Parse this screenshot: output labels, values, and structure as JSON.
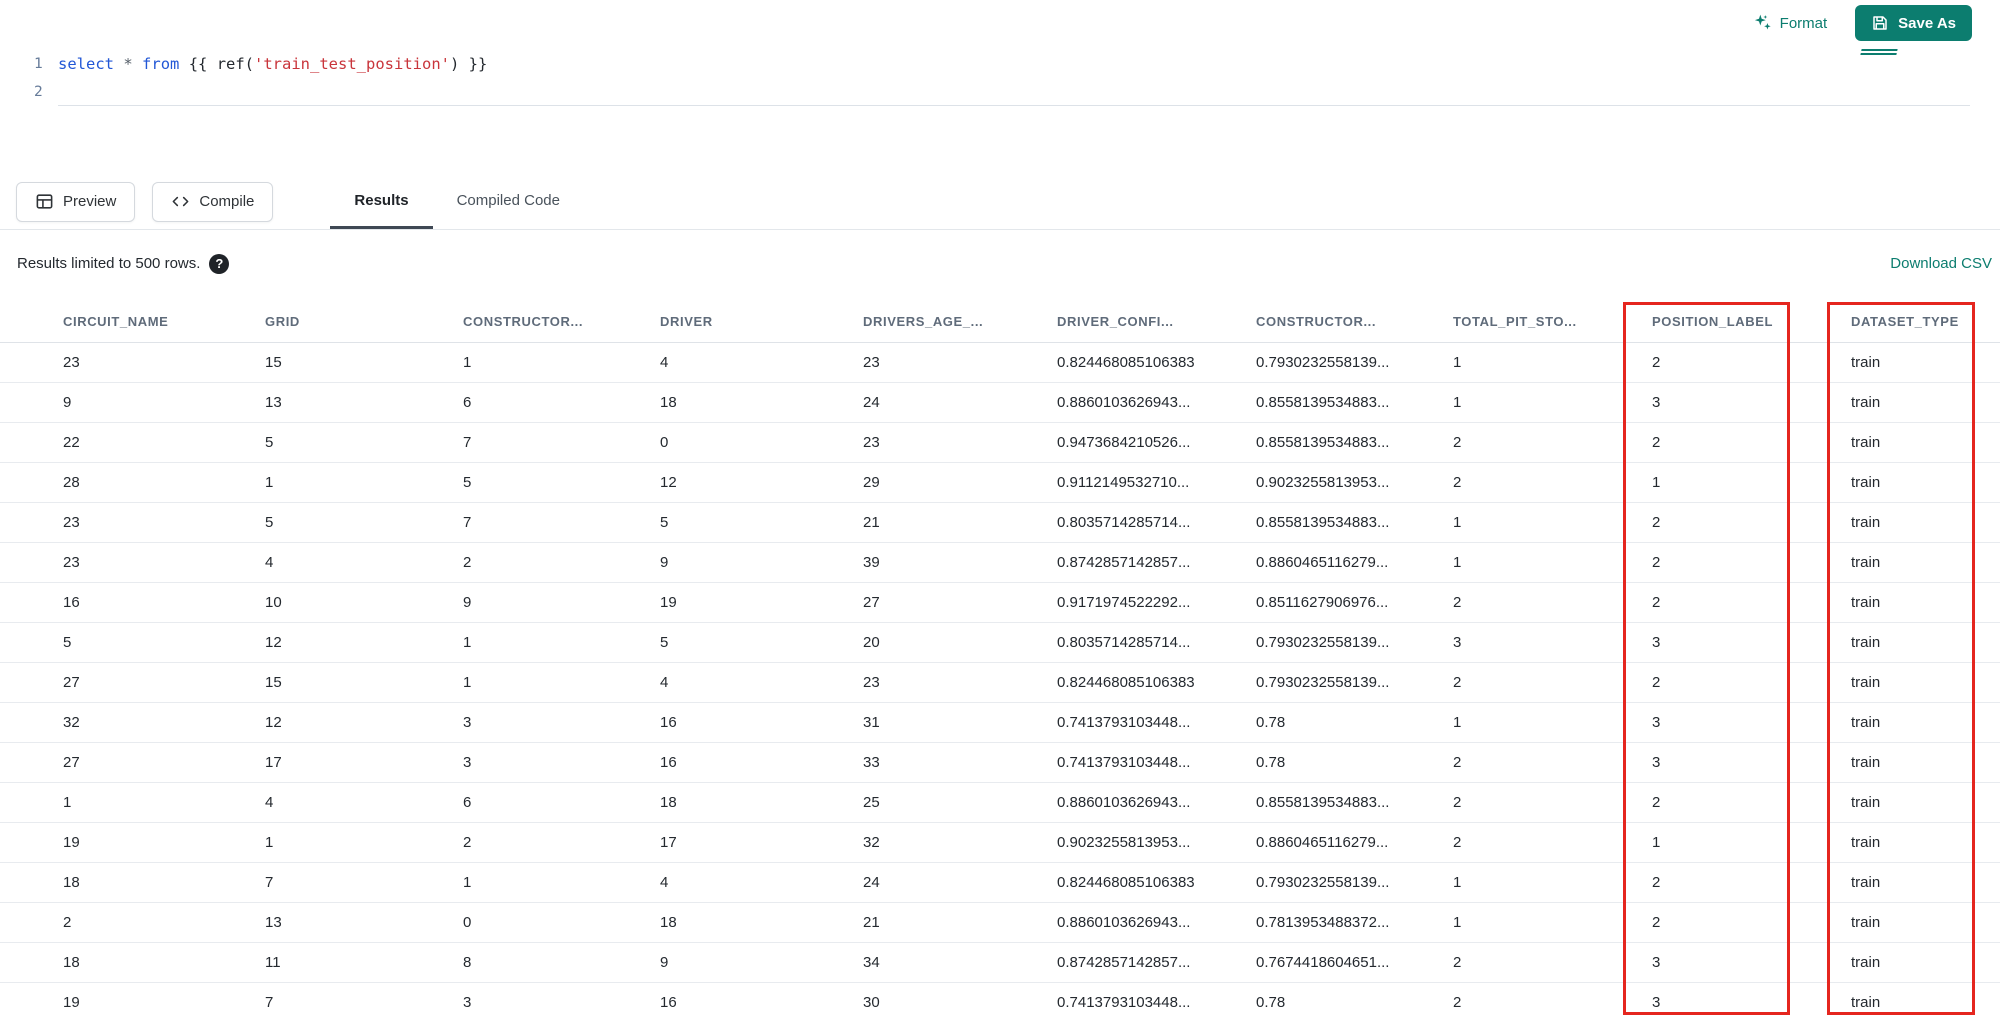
{
  "toolbar": {
    "format_label": "Format",
    "save_as_label": "Save As"
  },
  "editor": {
    "line_numbers": [
      "1",
      "2"
    ],
    "tokens": [
      {
        "text": "select",
        "type": "keyword"
      },
      {
        "text": " ",
        "type": "plain"
      },
      {
        "text": "*",
        "type": "operator"
      },
      {
        "text": " ",
        "type": "plain"
      },
      {
        "text": "from",
        "type": "keyword"
      },
      {
        "text": " {{ ",
        "type": "jinja"
      },
      {
        "text": "ref(",
        "type": "plain"
      },
      {
        "text": "'train_test_position'",
        "type": "string"
      },
      {
        "text": ") }}",
        "type": "jinja"
      }
    ]
  },
  "actions": {
    "preview_label": "Preview",
    "compile_label": "Compile"
  },
  "tabs": [
    {
      "label": "Results",
      "active": true
    },
    {
      "label": "Compiled Code",
      "active": false
    }
  ],
  "results": {
    "limit_text": "Results limited to 500 rows.",
    "help_glyph": "?",
    "download_csv_label": "Download CSV"
  },
  "table": {
    "columns": [
      "CIRCUIT_NAME",
      "GRID",
      "CONSTRUCTOR...",
      "DRIVER",
      "DRIVERS_AGE_...",
      "DRIVER_CONFI...",
      "CONSTRUCTOR...",
      "TOTAL_PIT_STO...",
      "POSITION_LABEL",
      "DATASET_TYPE"
    ],
    "rows": [
      [
        "23",
        "15",
        "1",
        "4",
        "23",
        "0.824468085106383",
        "0.7930232558139...",
        "1",
        "2",
        "train"
      ],
      [
        "9",
        "13",
        "6",
        "18",
        "24",
        "0.8860103626943...",
        "0.8558139534883...",
        "1",
        "3",
        "train"
      ],
      [
        "22",
        "5",
        "7",
        "0",
        "23",
        "0.9473684210526...",
        "0.8558139534883...",
        "2",
        "2",
        "train"
      ],
      [
        "28",
        "1",
        "5",
        "12",
        "29",
        "0.9112149532710...",
        "0.9023255813953...",
        "2",
        "1",
        "train"
      ],
      [
        "23",
        "5",
        "7",
        "5",
        "21",
        "0.8035714285714...",
        "0.8558139534883...",
        "1",
        "2",
        "train"
      ],
      [
        "23",
        "4",
        "2",
        "9",
        "39",
        "0.8742857142857...",
        "0.8860465116279...",
        "1",
        "2",
        "train"
      ],
      [
        "16",
        "10",
        "9",
        "19",
        "27",
        "0.9171974522292...",
        "0.8511627906976...",
        "2",
        "2",
        "train"
      ],
      [
        "5",
        "12",
        "1",
        "5",
        "20",
        "0.8035714285714...",
        "0.7930232558139...",
        "3",
        "3",
        "train"
      ],
      [
        "27",
        "15",
        "1",
        "4",
        "23",
        "0.824468085106383",
        "0.7930232558139...",
        "2",
        "2",
        "train"
      ],
      [
        "32",
        "12",
        "3",
        "16",
        "31",
        "0.7413793103448...",
        "0.78",
        "1",
        "3",
        "train"
      ],
      [
        "27",
        "17",
        "3",
        "16",
        "33",
        "0.7413793103448...",
        "0.78",
        "2",
        "3",
        "train"
      ],
      [
        "1",
        "4",
        "6",
        "18",
        "25",
        "0.8860103626943...",
        "0.8558139534883...",
        "2",
        "2",
        "train"
      ],
      [
        "19",
        "1",
        "2",
        "17",
        "32",
        "0.9023255813953...",
        "0.8860465116279...",
        "2",
        "1",
        "train"
      ],
      [
        "18",
        "7",
        "1",
        "4",
        "24",
        "0.824468085106383",
        "0.7930232558139...",
        "1",
        "2",
        "train"
      ],
      [
        "2",
        "13",
        "0",
        "18",
        "21",
        "0.8860103626943...",
        "0.7813953488372...",
        "1",
        "2",
        "train"
      ],
      [
        "18",
        "11",
        "8",
        "9",
        "34",
        "0.8742857142857...",
        "0.7674418604651...",
        "2",
        "3",
        "train"
      ],
      [
        "19",
        "7",
        "3",
        "16",
        "30",
        "0.7413793103448...",
        "0.78",
        "2",
        "3",
        "train"
      ]
    ]
  },
  "colors": {
    "accent_teal": "#0c7d6f",
    "annotation_red": "#e5261f",
    "keyword_blue": "#2257d6",
    "string_red": "#c9353b"
  }
}
